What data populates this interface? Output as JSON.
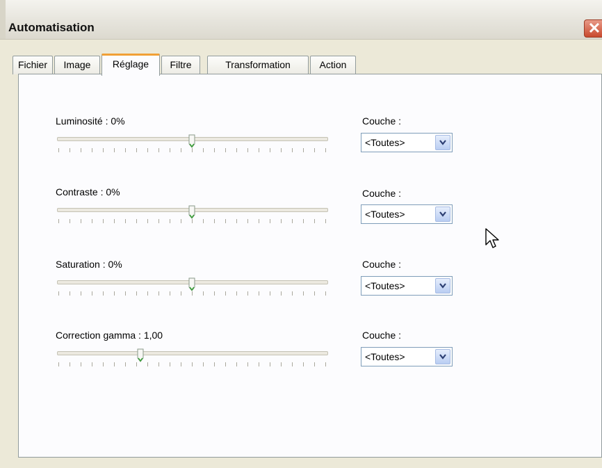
{
  "window": {
    "title": "Automatisation",
    "close_label": "✕"
  },
  "tabs": [
    {
      "label": "Fichier",
      "active": false
    },
    {
      "label": "Image",
      "active": false
    },
    {
      "label": "Réglage",
      "active": true
    },
    {
      "label": "Filtre",
      "active": false
    },
    {
      "label": "Transformation",
      "active": false
    },
    {
      "label": "Action",
      "active": false
    }
  ],
  "settings": [
    {
      "label": "Luminosité : 0%",
      "slider_value": 0.5,
      "couche_label": "Couche :",
      "couche_value": "<Toutes>"
    },
    {
      "label": "Contraste : 0%",
      "slider_value": 0.5,
      "couche_label": "Couche :",
      "couche_value": "<Toutes>"
    },
    {
      "label": "Saturation : 0%",
      "slider_value": 0.5,
      "couche_label": "Couche :",
      "couche_value": "<Toutes>"
    },
    {
      "label": "Correction gamma : 1,00",
      "slider_value": 0.31,
      "couche_label": "Couche :",
      "couche_value": "<Toutes>"
    }
  ],
  "icons": {
    "close": "close-icon",
    "dropdown": "chevron-down-icon",
    "cursor": "mouse-pointer-icon"
  }
}
